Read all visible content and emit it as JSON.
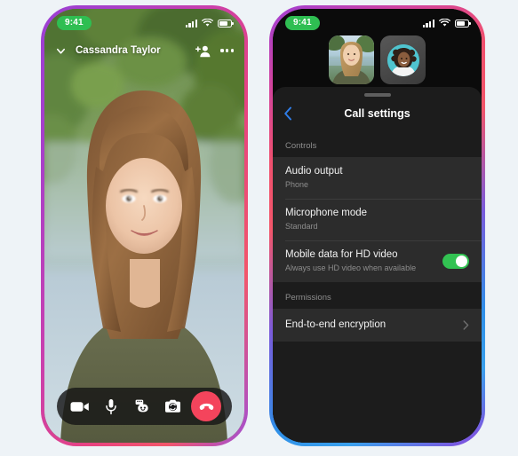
{
  "left_phone": {
    "status_bar": {
      "time": "9:41",
      "signal_icon": "cellular-bars-icon",
      "wifi_icon": "wifi-icon",
      "battery_icon": "battery-icon"
    },
    "call_header": {
      "collapse_icon": "chevron-down-icon",
      "caller_name": "Cassandra Taylor",
      "add_person_icon": "add-person-icon",
      "more_icon": "more-options-icon"
    },
    "controls": [
      {
        "name": "video-camera",
        "icon": "video-camera-icon"
      },
      {
        "name": "microphone",
        "icon": "microphone-icon"
      },
      {
        "name": "effects",
        "icon": "effects-sticker-icon"
      },
      {
        "name": "flip-camera",
        "icon": "flip-camera-icon"
      },
      {
        "name": "end-call",
        "icon": "end-call-icon"
      }
    ]
  },
  "right_phone": {
    "status_bar": {
      "time": "9:41",
      "signal_icon": "cellular-bars-icon",
      "wifi_icon": "wifi-icon",
      "battery_icon": "battery-icon"
    },
    "thumbnails": [
      {
        "name": "participant-video-thumbnail",
        "kind": "video"
      },
      {
        "name": "participant-avatar-thumbnail",
        "kind": "avatar"
      }
    ],
    "sheet": {
      "grabber_icon": "drag-handle-icon",
      "back_icon": "back-chevron-icon",
      "title": "Call settings",
      "sections": [
        {
          "header": "Controls",
          "rows": [
            {
              "title": "Audio output",
              "subtitle": "Phone",
              "control": "none"
            },
            {
              "title": "Microphone mode",
              "subtitle": "Standard",
              "control": "none"
            },
            {
              "title": "Mobile data for HD video",
              "subtitle": "Always use HD video when available",
              "control": "toggle",
              "toggle_on": true
            }
          ]
        },
        {
          "header": "Permissions",
          "rows": [
            {
              "title": "End-to-end encryption",
              "subtitle": "",
              "control": "chevron"
            }
          ]
        }
      ]
    }
  },
  "colors": {
    "page_background": "#eef3f7",
    "toggle_on": "#32c252",
    "end_call_red": "#f4445c",
    "status_time_green": "#2fbe52",
    "back_chevron_blue": "#2f7de8",
    "sheet_background": "#1c1c1c",
    "row_background": "#2c2c2c"
  }
}
